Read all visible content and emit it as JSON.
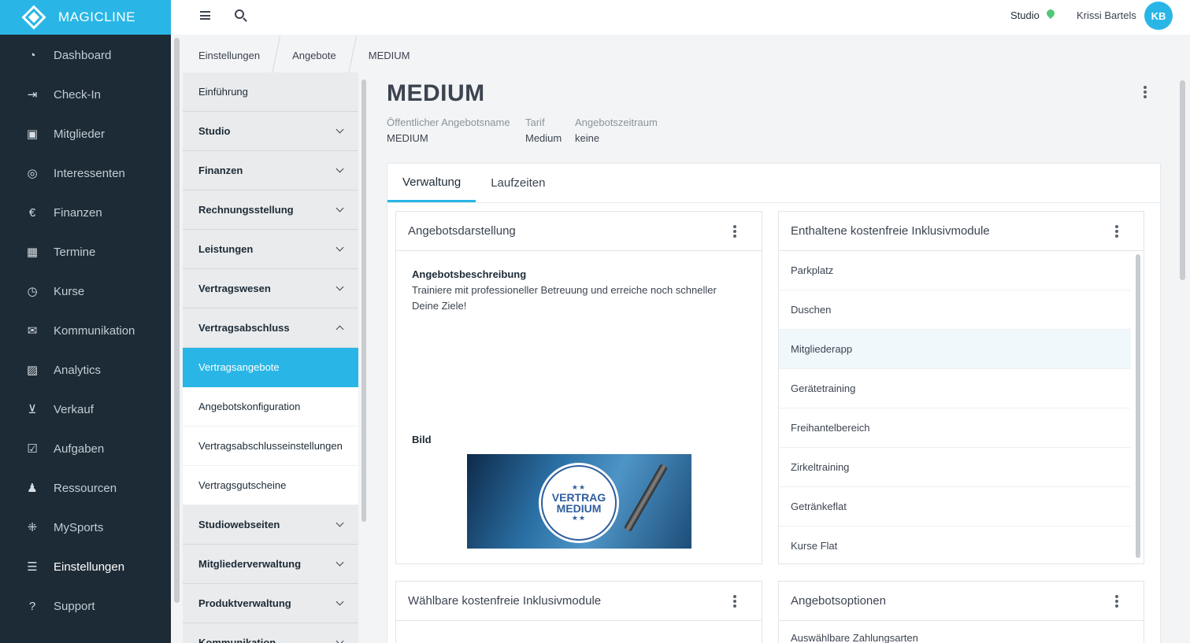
{
  "brand": {
    "name": "MAGICLINE"
  },
  "sidebar": {
    "items": [
      {
        "label": "Dashboard",
        "icon": "dashboard-icon"
      },
      {
        "label": "Check-In",
        "icon": "check-in-icon"
      },
      {
        "label": "Mitglieder",
        "icon": "members-icon"
      },
      {
        "label": "Interessenten",
        "icon": "leads-icon"
      },
      {
        "label": "Finanzen",
        "icon": "euro-icon"
      },
      {
        "label": "Termine",
        "icon": "calendar-icon"
      },
      {
        "label": "Kurse",
        "icon": "stopwatch-icon"
      },
      {
        "label": "Kommunikation",
        "icon": "chat-icon"
      },
      {
        "label": "Analytics",
        "icon": "chart-icon"
      },
      {
        "label": "Verkauf",
        "icon": "cart-icon"
      },
      {
        "label": "Aufgaben",
        "icon": "checkbox-icon"
      },
      {
        "label": "Ressourcen",
        "icon": "group-icon"
      },
      {
        "label": "MySports",
        "icon": "grid-icon"
      },
      {
        "label": "Einstellungen",
        "icon": "sliders-icon"
      },
      {
        "label": "Support",
        "icon": "help-icon"
      }
    ],
    "active": "Einstellungen"
  },
  "topbar": {
    "studio": "Studio",
    "user_name": "Krissi Bartels",
    "user_initials": "KB"
  },
  "breadcrumb": [
    "Einstellungen",
    "Angebote",
    "MEDIUM"
  ],
  "settings_nav": {
    "items": [
      {
        "label": "Einführung",
        "type": "plain"
      },
      {
        "label": "Studio",
        "type": "group"
      },
      {
        "label": "Finanzen",
        "type": "group"
      },
      {
        "label": "Rechnungsstellung",
        "type": "group"
      },
      {
        "label": "Leistungen",
        "type": "group"
      },
      {
        "label": "Vertragswesen",
        "type": "group"
      },
      {
        "label": "Vertragsabschluss",
        "type": "group-open"
      },
      {
        "label": "Vertragsangebote",
        "type": "sub-active"
      },
      {
        "label": "Angebotskonfiguration",
        "type": "sub"
      },
      {
        "label": "Vertragsabschlusseinstellungen",
        "type": "sub"
      },
      {
        "label": "Vertragsgutscheine",
        "type": "sub"
      },
      {
        "label": "Studiowebseiten",
        "type": "group"
      },
      {
        "label": "Mitgliederverwaltung",
        "type": "group"
      },
      {
        "label": "Produktverwaltung",
        "type": "group"
      },
      {
        "label": "Kommunikation",
        "type": "group"
      }
    ]
  },
  "offer": {
    "title": "MEDIUM",
    "meta": [
      {
        "label": "Öffentlicher Angebotsname",
        "value": "MEDIUM"
      },
      {
        "label": "Tarif",
        "value": "Medium"
      },
      {
        "label": "Angebotszeitraum",
        "value": "keine"
      }
    ]
  },
  "tabs": [
    "Verwaltung",
    "Laufzeiten"
  ],
  "cards": {
    "presentation": {
      "title": "Angebotsdarstellung",
      "description_label": "Angebotsbeschreibung",
      "description": "Trainiere mit professioneller Betreuung und erreiche noch schneller Deine Ziele!",
      "image_label": "Bild",
      "image_text_1": "VERTRAG",
      "image_text_2": "MEDIUM",
      "image_stars": "★★"
    },
    "included_modules": {
      "title": "Enthaltene kostenfreie Inklusivmodule",
      "items": [
        "Parkplatz",
        "Duschen",
        "Mitgliederapp",
        "Gerätetraining",
        "Freihantelbereich",
        "Zirkeltraining",
        "Getränkeflat",
        "Kurse Flat"
      ]
    },
    "selectable_modules": {
      "title": "Wählbare kostenfreie Inklusivmodule"
    },
    "offer_options": {
      "title": "Angebotsoptionen",
      "first_item": "Auswählbare Zahlungsarten"
    }
  },
  "colors": {
    "accent": "#29b6e6",
    "sidebar": "#1d2b36",
    "pin": "#50c878"
  }
}
